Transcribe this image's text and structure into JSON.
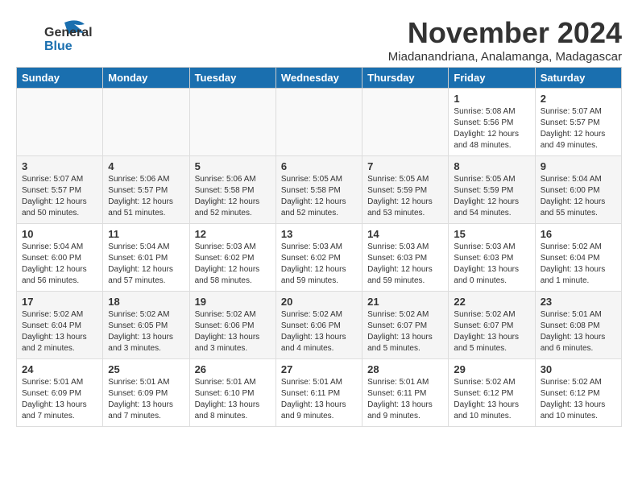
{
  "logo": {
    "general": "General",
    "blue": "Blue"
  },
  "title": "November 2024",
  "subtitle": "Miadanandriana, Analamanga, Madagascar",
  "headers": [
    "Sunday",
    "Monday",
    "Tuesday",
    "Wednesday",
    "Thursday",
    "Friday",
    "Saturday"
  ],
  "weeks": [
    {
      "days": [
        {
          "num": "",
          "info": "",
          "empty": true
        },
        {
          "num": "",
          "info": "",
          "empty": true
        },
        {
          "num": "",
          "info": "",
          "empty": true
        },
        {
          "num": "",
          "info": "",
          "empty": true
        },
        {
          "num": "",
          "info": "",
          "empty": true
        },
        {
          "num": "1",
          "info": "Sunrise: 5:08 AM\nSunset: 5:56 PM\nDaylight: 12 hours\nand 48 minutes.",
          "empty": false
        },
        {
          "num": "2",
          "info": "Sunrise: 5:07 AM\nSunset: 5:57 PM\nDaylight: 12 hours\nand 49 minutes.",
          "empty": false
        }
      ]
    },
    {
      "days": [
        {
          "num": "3",
          "info": "Sunrise: 5:07 AM\nSunset: 5:57 PM\nDaylight: 12 hours\nand 50 minutes.",
          "empty": false
        },
        {
          "num": "4",
          "info": "Sunrise: 5:06 AM\nSunset: 5:57 PM\nDaylight: 12 hours\nand 51 minutes.",
          "empty": false
        },
        {
          "num": "5",
          "info": "Sunrise: 5:06 AM\nSunset: 5:58 PM\nDaylight: 12 hours\nand 52 minutes.",
          "empty": false
        },
        {
          "num": "6",
          "info": "Sunrise: 5:05 AM\nSunset: 5:58 PM\nDaylight: 12 hours\nand 52 minutes.",
          "empty": false
        },
        {
          "num": "7",
          "info": "Sunrise: 5:05 AM\nSunset: 5:59 PM\nDaylight: 12 hours\nand 53 minutes.",
          "empty": false
        },
        {
          "num": "8",
          "info": "Sunrise: 5:05 AM\nSunset: 5:59 PM\nDaylight: 12 hours\nand 54 minutes.",
          "empty": false
        },
        {
          "num": "9",
          "info": "Sunrise: 5:04 AM\nSunset: 6:00 PM\nDaylight: 12 hours\nand 55 minutes.",
          "empty": false
        }
      ]
    },
    {
      "days": [
        {
          "num": "10",
          "info": "Sunrise: 5:04 AM\nSunset: 6:00 PM\nDaylight: 12 hours\nand 56 minutes.",
          "empty": false
        },
        {
          "num": "11",
          "info": "Sunrise: 5:04 AM\nSunset: 6:01 PM\nDaylight: 12 hours\nand 57 minutes.",
          "empty": false
        },
        {
          "num": "12",
          "info": "Sunrise: 5:03 AM\nSunset: 6:02 PM\nDaylight: 12 hours\nand 58 minutes.",
          "empty": false
        },
        {
          "num": "13",
          "info": "Sunrise: 5:03 AM\nSunset: 6:02 PM\nDaylight: 12 hours\nand 59 minutes.",
          "empty": false
        },
        {
          "num": "14",
          "info": "Sunrise: 5:03 AM\nSunset: 6:03 PM\nDaylight: 12 hours\nand 59 minutes.",
          "empty": false
        },
        {
          "num": "15",
          "info": "Sunrise: 5:03 AM\nSunset: 6:03 PM\nDaylight: 13 hours\nand 0 minutes.",
          "empty": false
        },
        {
          "num": "16",
          "info": "Sunrise: 5:02 AM\nSunset: 6:04 PM\nDaylight: 13 hours\nand 1 minute.",
          "empty": false
        }
      ]
    },
    {
      "days": [
        {
          "num": "17",
          "info": "Sunrise: 5:02 AM\nSunset: 6:04 PM\nDaylight: 13 hours\nand 2 minutes.",
          "empty": false
        },
        {
          "num": "18",
          "info": "Sunrise: 5:02 AM\nSunset: 6:05 PM\nDaylight: 13 hours\nand 3 minutes.",
          "empty": false
        },
        {
          "num": "19",
          "info": "Sunrise: 5:02 AM\nSunset: 6:06 PM\nDaylight: 13 hours\nand 3 minutes.",
          "empty": false
        },
        {
          "num": "20",
          "info": "Sunrise: 5:02 AM\nSunset: 6:06 PM\nDaylight: 13 hours\nand 4 minutes.",
          "empty": false
        },
        {
          "num": "21",
          "info": "Sunrise: 5:02 AM\nSunset: 6:07 PM\nDaylight: 13 hours\nand 5 minutes.",
          "empty": false
        },
        {
          "num": "22",
          "info": "Sunrise: 5:02 AM\nSunset: 6:07 PM\nDaylight: 13 hours\nand 5 minutes.",
          "empty": false
        },
        {
          "num": "23",
          "info": "Sunrise: 5:01 AM\nSunset: 6:08 PM\nDaylight: 13 hours\nand 6 minutes.",
          "empty": false
        }
      ]
    },
    {
      "days": [
        {
          "num": "24",
          "info": "Sunrise: 5:01 AM\nSunset: 6:09 PM\nDaylight: 13 hours\nand 7 minutes.",
          "empty": false
        },
        {
          "num": "25",
          "info": "Sunrise: 5:01 AM\nSunset: 6:09 PM\nDaylight: 13 hours\nand 7 minutes.",
          "empty": false
        },
        {
          "num": "26",
          "info": "Sunrise: 5:01 AM\nSunset: 6:10 PM\nDaylight: 13 hours\nand 8 minutes.",
          "empty": false
        },
        {
          "num": "27",
          "info": "Sunrise: 5:01 AM\nSunset: 6:11 PM\nDaylight: 13 hours\nand 9 minutes.",
          "empty": false
        },
        {
          "num": "28",
          "info": "Sunrise: 5:01 AM\nSunset: 6:11 PM\nDaylight: 13 hours\nand 9 minutes.",
          "empty": false
        },
        {
          "num": "29",
          "info": "Sunrise: 5:02 AM\nSunset: 6:12 PM\nDaylight: 13 hours\nand 10 minutes.",
          "empty": false
        },
        {
          "num": "30",
          "info": "Sunrise: 5:02 AM\nSunset: 6:12 PM\nDaylight: 13 hours\nand 10 minutes.",
          "empty": false
        }
      ]
    }
  ]
}
